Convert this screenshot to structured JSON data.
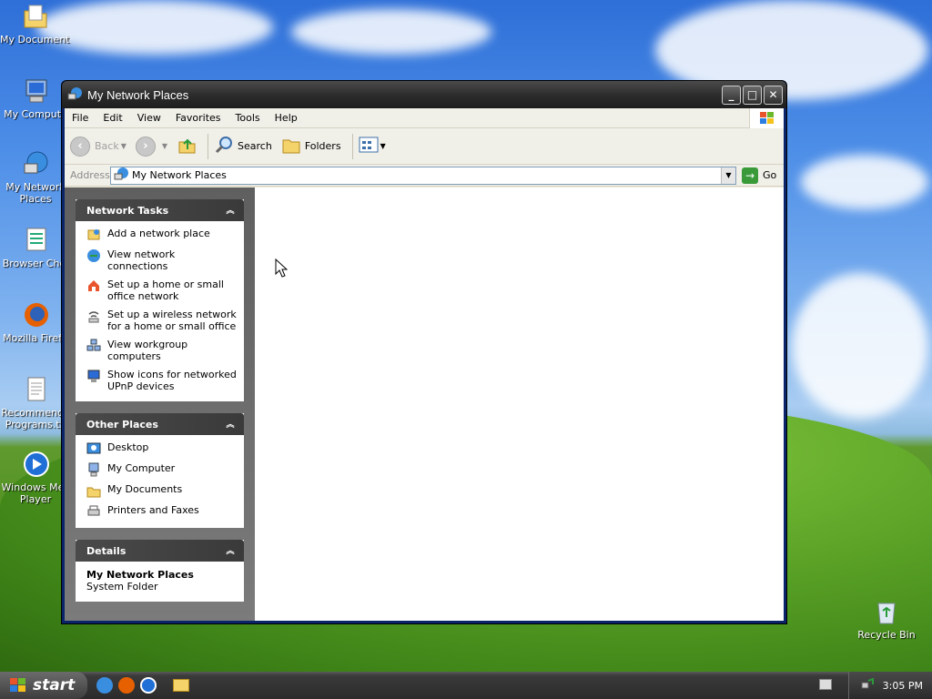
{
  "desktop": {
    "icons": [
      {
        "label": "My Documents",
        "icon": "my-documents-icon"
      },
      {
        "label": "My Compute",
        "icon": "my-computer-icon"
      },
      {
        "label": "My Network Places",
        "line1": "My Network",
        "line2": "Places",
        "icon": "network-places-icon"
      },
      {
        "label": "Browser Choi",
        "icon": "browser-choice-icon"
      },
      {
        "label": "Mozilla Firefo",
        "icon": "firefox-icon"
      },
      {
        "label": "Recommended Programs.tx",
        "line1": "Recommende",
        "line2": "Programs.tx",
        "icon": "text-file-icon"
      },
      {
        "label": "Windows Media Player",
        "line1": "Windows Mec",
        "line2": "Player",
        "icon": "media-player-icon"
      },
      {
        "label": "Recycle Bin",
        "icon": "recycle-bin-icon"
      }
    ]
  },
  "window": {
    "title": "My Network Places",
    "menu": [
      "File",
      "Edit",
      "View",
      "Favorites",
      "Tools",
      "Help"
    ],
    "toolbar": {
      "back": "Back",
      "search": "Search",
      "folders": "Folders"
    },
    "address": {
      "label": "Address",
      "value": "My Network Places",
      "go": "Go"
    },
    "network_tasks": {
      "title": "Network Tasks",
      "items": [
        {
          "line1": "Add a network place",
          "line2": ""
        },
        {
          "line1": "View network connections",
          "line2": ""
        },
        {
          "line1": "Set up a home or small",
          "line2": "office network"
        },
        {
          "line1": "Set up a wireless network",
          "line2": "for a home or small office"
        },
        {
          "line1": "View workgroup computers",
          "line2": ""
        },
        {
          "line1": "Show icons for networked",
          "line2": "UPnP devices"
        }
      ]
    },
    "other_places": {
      "title": "Other Places",
      "items": [
        "Desktop",
        "My Computer",
        "My Documents",
        "Printers and Faxes"
      ]
    },
    "details": {
      "title": "Details",
      "name": "My Network Places",
      "type": "System Folder"
    }
  },
  "taskbar": {
    "start": "start",
    "clock": "3:05 PM"
  }
}
